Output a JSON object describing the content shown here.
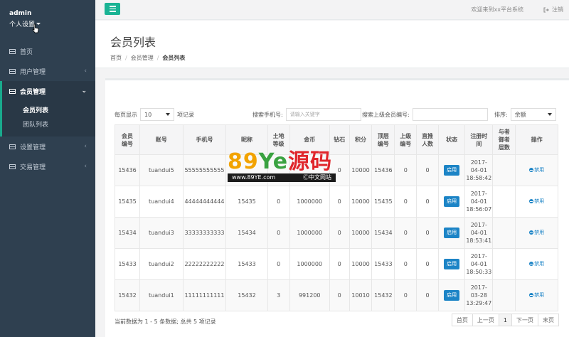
{
  "sidebar": {
    "profile": {
      "name": "admin",
      "settings_label": "个人设置"
    },
    "items": [
      {
        "label": "首页",
        "icon": "grid-icon",
        "arrow": ""
      },
      {
        "label": "用户管理",
        "icon": "grid-icon",
        "arrow": "‹"
      },
      {
        "label": "会员管理",
        "icon": "grid-icon",
        "arrow": "⌄"
      },
      {
        "label": "设置管理",
        "icon": "grid-icon",
        "arrow": "‹"
      },
      {
        "label": "交易管理",
        "icon": "grid-icon",
        "arrow": "‹"
      }
    ],
    "subitems": [
      {
        "label": "会员列表"
      },
      {
        "label": "团队列表"
      }
    ]
  },
  "topbar": {
    "welcome": "欢迎来到xx平台系统",
    "logout_label": "注销"
  },
  "heading": {
    "title": "会员列表",
    "breadcrumb": [
      "首页",
      "会员管理",
      "会员列表"
    ]
  },
  "controls": {
    "per_page_label": "每页显示",
    "per_page_value": "10",
    "per_page_suffix": "项记录",
    "search_phone_label": "搜索手机号:",
    "search_phone_placeholder": "请输入关键字",
    "search_parent_label": "搜索上级会员编号:",
    "search_parent_placeholder": "",
    "sort_label": "排序:",
    "sort_value": "余额"
  },
  "table": {
    "headers": [
      "会员\n编号",
      "账号",
      "手机号",
      "昵称",
      "土地\n等级",
      "金币",
      "钻石",
      "积分",
      "顶层\n编号",
      "上级\n编号",
      "直推\n人数",
      "状态",
      "注册时\n间",
      "与者\n御者\n层数",
      "操作"
    ],
    "status_label": "启用",
    "action_label": "禁用",
    "rows": [
      {
        "id": "15436",
        "account": "tuandui5",
        "phone": "55555555555",
        "nickname": "",
        "land": "",
        "gold": "",
        "diamond": "0",
        "points": "10000",
        "top": "15436",
        "parent": "0",
        "direct": "0",
        "date": "2017-",
        "time1": "04-01",
        "time2": "18:58:42"
      },
      {
        "id": "15435",
        "account": "tuandui4",
        "phone": "44444444444",
        "nickname": "15435",
        "land": "0",
        "gold": "1000000",
        "diamond": "0",
        "points": "10000",
        "top": "15435",
        "parent": "0",
        "direct": "0",
        "date": "2017-",
        "time1": "04-01",
        "time2": "18:56:07"
      },
      {
        "id": "15434",
        "account": "tuandui3",
        "phone": "33333333333",
        "nickname": "15434",
        "land": "0",
        "gold": "1000000",
        "diamond": "0",
        "points": "10000",
        "top": "15434",
        "parent": "0",
        "direct": "0",
        "date": "2017-",
        "time1": "04-01",
        "time2": "18:53:41"
      },
      {
        "id": "15433",
        "account": "tuandui2",
        "phone": "22222222222",
        "nickname": "15433",
        "land": "0",
        "gold": "1000000",
        "diamond": "0",
        "points": "10000",
        "top": "15433",
        "parent": "0",
        "direct": "0",
        "date": "2017-",
        "time1": "04-01",
        "time2": "18:50:33"
      },
      {
        "id": "15432",
        "account": "tuandui1",
        "phone": "11111111111",
        "nickname": "15432",
        "land": "3",
        "gold": "991200",
        "diamond": "0",
        "points": "10010",
        "top": "15432",
        "parent": "0",
        "direct": "0",
        "date": "2017-",
        "time1": "03-28",
        "time2": "13:29:47"
      }
    ]
  },
  "footer": {
    "info": "当前数据为 1 - 5 条数据; 总共 5 项记录",
    "pager": [
      "首页",
      "上一页",
      "1",
      "下一页",
      "末页"
    ]
  },
  "watermark": {
    "main_prefix": "89",
    "main_mid": "Ye",
    "main_suffix": "源码",
    "sub_left": "www.89YE.com",
    "sub_right": "Ⓒ中文网站"
  },
  "colors": {
    "sidebar_bg": "#2f4050",
    "accent": "#1ab394",
    "badge": "#1c84c6"
  }
}
